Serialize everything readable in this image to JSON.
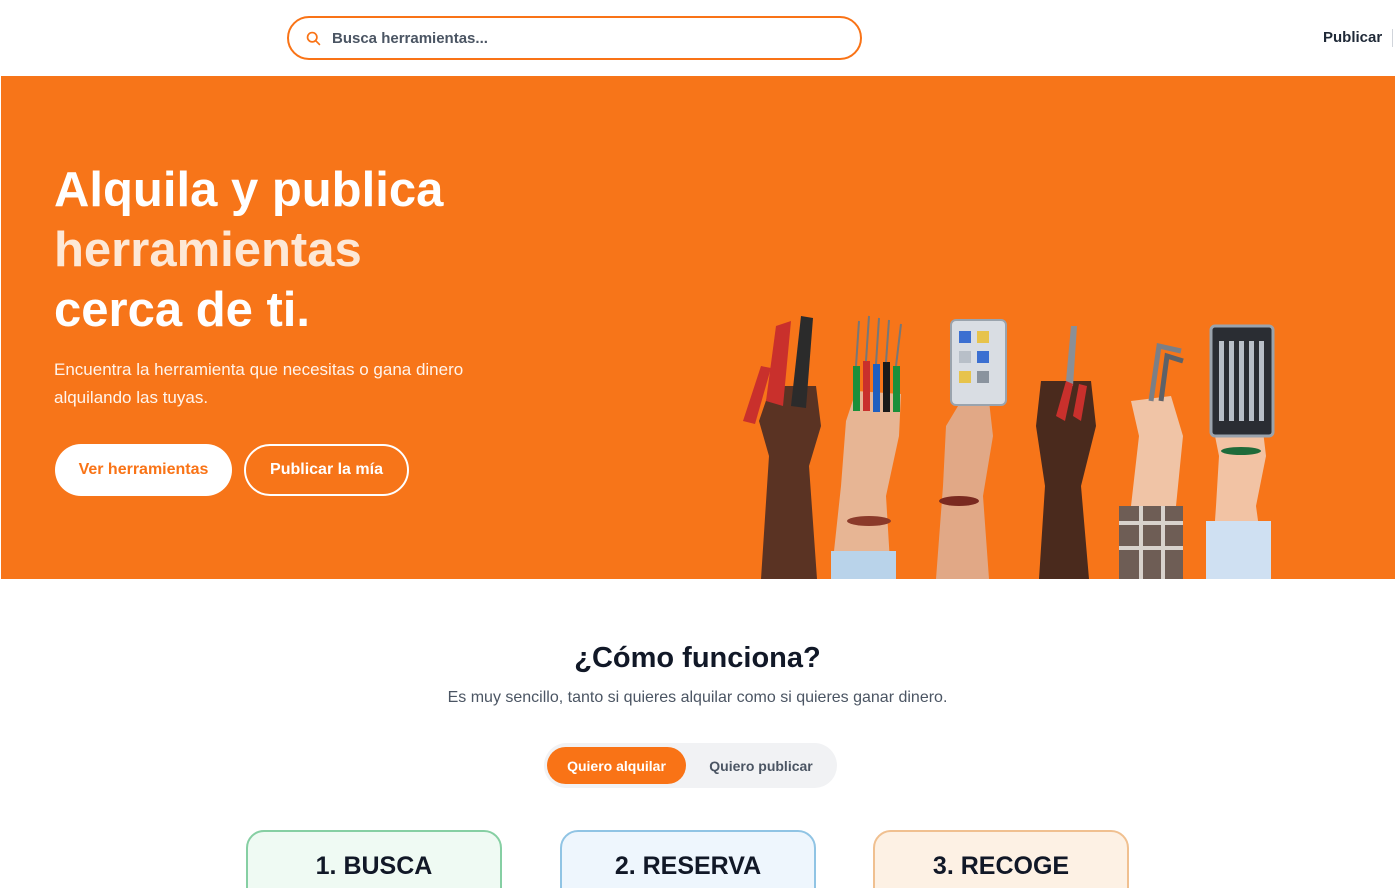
{
  "header": {
    "search_placeholder": "Busca herramientas...",
    "publish_link": "Publicar"
  },
  "hero": {
    "title_line1": "Alquila y publica",
    "title_line2": "herramientas",
    "title_line3": "cerca de ti.",
    "subtitle": "Encuentra la herramienta que necesitas o gana dinero alquilando las tuyas.",
    "primary_button": "Ver herramientas",
    "secondary_button": "Publicar la mía",
    "background_color": "#f77519"
  },
  "how_it_works": {
    "title": "¿Cómo funciona?",
    "subtitle": "Es muy sencillo, tanto si quieres alquilar como si quieres ganar dinero.",
    "toggle": {
      "active": "Quiero alquilar",
      "inactive": "Quiero publicar"
    },
    "steps": [
      {
        "label": "1. BUSCA",
        "color": "#86cfa3"
      },
      {
        "label": "2. RESERVA",
        "color": "#90c4e4"
      },
      {
        "label": "3. RECOGE",
        "color": "#f0c090"
      }
    ]
  },
  "colors": {
    "accent": "#f97316"
  }
}
